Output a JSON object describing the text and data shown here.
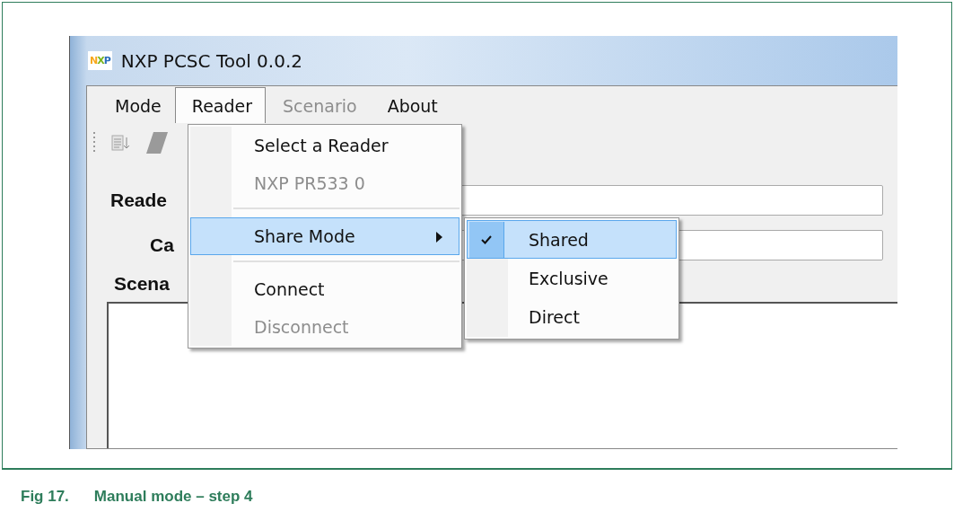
{
  "window": {
    "title": "NXP PCSC Tool 0.0.2",
    "logo_text": "NXP"
  },
  "menu_bar": [
    {
      "label": "Mode",
      "disabled": false,
      "open": false
    },
    {
      "label": "Reader",
      "disabled": false,
      "open": true
    },
    {
      "label": "Scenario",
      "disabled": true,
      "open": false
    },
    {
      "label": "About",
      "disabled": false,
      "open": false
    }
  ],
  "reader_menu": [
    {
      "kind": "item",
      "label": "Select a Reader",
      "disabled": false,
      "highlighted": false
    },
    {
      "kind": "item",
      "label": "NXP PR533 0",
      "disabled": true,
      "highlighted": false
    },
    {
      "kind": "separator"
    },
    {
      "kind": "submenu",
      "label": "Share Mode",
      "disabled": false,
      "highlighted": true
    },
    {
      "kind": "separator"
    },
    {
      "kind": "item",
      "label": "Connect",
      "disabled": false,
      "highlighted": false
    },
    {
      "kind": "item",
      "label": "Disconnect",
      "disabled": true,
      "highlighted": false
    }
  ],
  "share_mode_menu": [
    {
      "label": "Shared",
      "checked": true,
      "highlighted": true
    },
    {
      "label": "Exclusive",
      "checked": false,
      "highlighted": false
    },
    {
      "label": "Direct",
      "checked": false,
      "highlighted": false
    }
  ],
  "form": {
    "fields": [
      {
        "label": "Reade"
      },
      {
        "label": "Ca"
      }
    ],
    "scenario_label": "Scena"
  },
  "caption": {
    "number": "Fig 17.",
    "text": "Manual mode – step 4"
  }
}
